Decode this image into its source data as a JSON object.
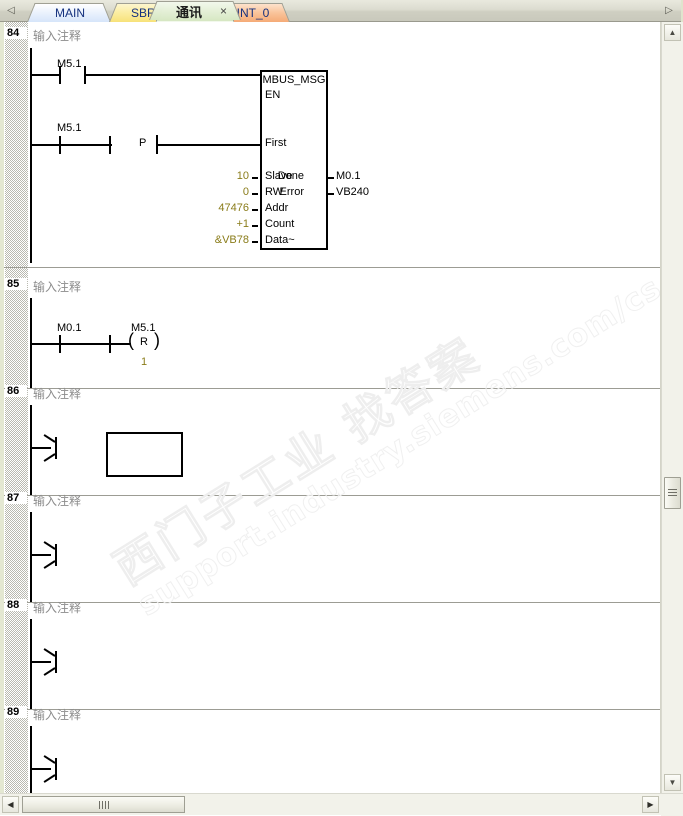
{
  "tabs": [
    {
      "id": "main",
      "label": "MAIN",
      "active": false,
      "closable": false
    },
    {
      "id": "sbr0",
      "label": "SBR_0",
      "active": false,
      "closable": false
    },
    {
      "id": "comm",
      "label": "通讯",
      "active": true,
      "closable": true
    },
    {
      "id": "int0",
      "label": "INT_0",
      "active": false,
      "closable": false
    }
  ],
  "tab_nav": {
    "left": "◁",
    "right": "▷",
    "close": "×"
  },
  "comment_placeholder": "输入注释",
  "networks": [
    {
      "number": "84",
      "comment": "输入注释"
    },
    {
      "number": "85",
      "comment": "输入注释"
    },
    {
      "number": "86",
      "comment": "输入注释"
    },
    {
      "number": "87",
      "comment": "输入注释"
    },
    {
      "number": "88",
      "comment": "输入注释"
    },
    {
      "number": "89",
      "comment": "输入注释"
    }
  ],
  "network84": {
    "contact1_label": "M5.1",
    "contact2_label": "M5.1",
    "positive_edge_label": "P",
    "block": {
      "name": "MBUS_MSG",
      "inputs": [
        {
          "pin": "EN",
          "value": ""
        },
        {
          "pin": "First",
          "value": ""
        },
        {
          "pin": "Slave",
          "value": "10"
        },
        {
          "pin": "RW",
          "value": "0"
        },
        {
          "pin": "Addr",
          "value": "47476"
        },
        {
          "pin": "Count",
          "value": "+1"
        },
        {
          "pin": "Data~",
          "value": "&VB78"
        }
      ],
      "outputs": [
        {
          "pin": "Done",
          "value": "M0.1"
        },
        {
          "pin": "Error",
          "value": "VB240"
        }
      ]
    }
  },
  "network85": {
    "contact1_label": "M0.1",
    "coil_label": "M5.1",
    "coil_type": "R",
    "coil_count": "1"
  },
  "network86": {
    "has_empty_box": true
  },
  "watermark": {
    "cn": "西门子工业  找答案",
    "url": "support.industry.siemens.com/cs"
  },
  "scrollbars": {
    "v_up": "▲",
    "v_down": "▼",
    "h_left": "◀",
    "h_right": "▶"
  },
  "colors": {
    "constant": "#8a7c1a",
    "comment": "#8c8c8c",
    "tab_text": "#15317e"
  }
}
